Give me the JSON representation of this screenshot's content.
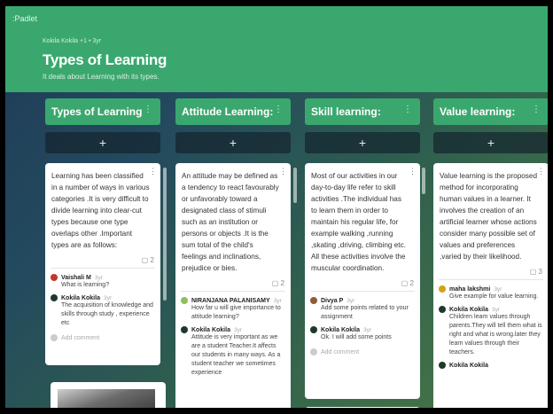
{
  "app": {
    "logo": ":Padlet"
  },
  "header": {
    "author": "Kokila Kokila +1 • 3yr",
    "title": "Types of Learning",
    "subtitle": "It deals about Learning with its types."
  },
  "columns": [
    {
      "name": "Types of Learning",
      "add": "+",
      "card": {
        "text": "Learning has been classified in a number of ways in various categories .It is very difficult to divide learning into clear-cut types because one type  overlaps other .Important types are as follows:",
        "comment_count": "2",
        "comments": [
          {
            "user": "Vaishali M",
            "ago": "3yr",
            "text": "What is learning?"
          },
          {
            "user": "Kokila Kokila",
            "ago": "3yr",
            "text": "The acquisition of knowledge and skills through study , experience etc"
          }
        ],
        "add_comment": "Add comment"
      }
    },
    {
      "name": "Attitude Learning:",
      "add": "+",
      "card": {
        "text": "An attitude may be defined as a tendency to react favourably or unfavorably toward a designated class of stimuli such as an institution or persons or objects .It is the sum total of the child's feelings and inclinations, prejudice or bies.",
        "comment_count": "2",
        "comments": [
          {
            "user": "NIRANJANA PALANISAMY",
            "ago": "3yr",
            "text": "How far u will give importance to attitude learning?"
          },
          {
            "user": "Kokila Kokila",
            "ago": "3yr",
            "text": "Attitude is very important as we are a student Teacher.It affects our students in many ways. As a student teacher we sometimes experience"
          }
        ]
      }
    },
    {
      "name": "Skill learning:",
      "add": "+",
      "card": {
        "text": "Most of our activities in our day-to-day  life refer to skill activities .The individual has to learn them in order to maintain his regular life, for example walking ,running ,skating ,driving, climbing etc. All these activities involve the muscular coordination.",
        "comment_count": "2",
        "comments": [
          {
            "user": "Divya P",
            "ago": "3yr",
            "text": "Add some points related to your assignment"
          },
          {
            "user": "Kokila Kokila",
            "ago": "3yr",
            "text": "Ok. I will add some points"
          }
        ],
        "add_comment": "Add comment"
      }
    },
    {
      "name": "Value learning:",
      "add": "+",
      "card": {
        "text": "Value learning is the proposed method for incorporating human values in a learner. It involves the creation of an artificial learner whose actions consider many possible set of values and preferences ,varied by their likelihood.",
        "comment_count": "3",
        "comments": [
          {
            "user": "maha lakshmi",
            "ago": "3yr",
            "text": "Give example for value learning."
          },
          {
            "user": "Kokila Kokila",
            "ago": "3yr",
            "text": "Children learn values through parents.They will tell them what is right and what is wrong.later they learn values through their teachers."
          }
        ],
        "partial_user": "Kokila Kokila"
      }
    }
  ],
  "colors": {
    "accent": "#3aa86e",
    "avatars": [
      "#c0392b",
      "#1e8449",
      "#8e5b3a",
      "#d4a017"
    ]
  }
}
